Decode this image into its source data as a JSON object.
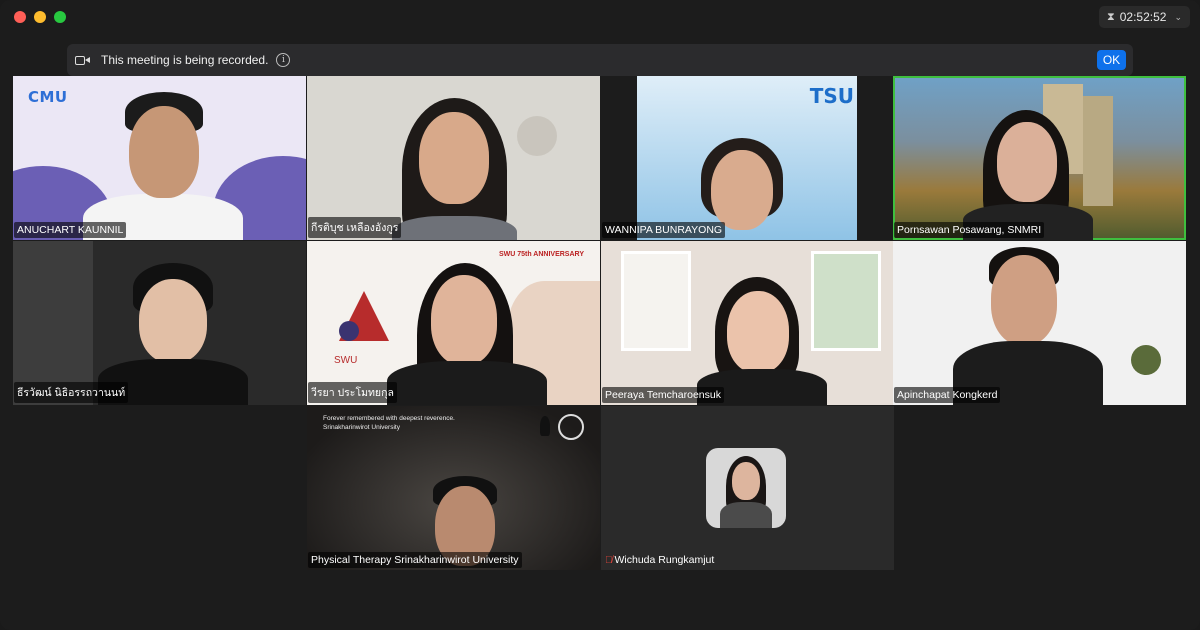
{
  "timer": {
    "elapsed": "02:52:52"
  },
  "recording_banner": {
    "message": "This meeting is being recorded.",
    "ok_label": "OK"
  },
  "participants": [
    {
      "name": "ANUCHART KAUNNIL",
      "logo": "CMU"
    },
    {
      "name": "กีรติบุช เหลืองอังกูร"
    },
    {
      "name": "WANNIPA BUNRAYONG",
      "logo": "TSU"
    },
    {
      "name": "Pornsawan Posawang, SNMRI"
    },
    {
      "name": "ธีรวัฒน์ นิธิอรรถวานนท์"
    },
    {
      "name": "วีรยา ประโมทยกุล",
      "banner": "SWU 75th ANNIVERSARY"
    },
    {
      "name": "Peeraya Temcharoensuk"
    },
    {
      "name": "Apinchapat Kongkerd"
    },
    {
      "name": "Physical Therapy Srinakharinwirot University",
      "banner_line1": "Forever remembered with deepest reverence.",
      "banner_line2": "Srinakharinwirot University"
    },
    {
      "name": "Wichuda Rungkamjut"
    }
  ],
  "colors": {
    "accent": "#0e71eb",
    "active_speaker": "#3fbf3f",
    "muted": "#e0443c"
  }
}
